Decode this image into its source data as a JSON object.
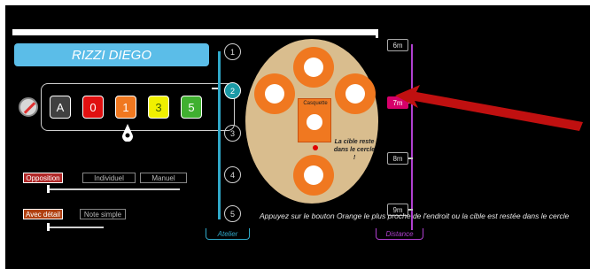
{
  "player": {
    "name": "RIZZI  DIEGO"
  },
  "score_buttons": [
    {
      "label": "A",
      "color": "#404040",
      "border": "#ffffff",
      "text_color": "#ffffff"
    },
    {
      "label": "0",
      "color": "#e01010",
      "border": "#ffffff",
      "text_color": "#ffffff"
    },
    {
      "label": "1",
      "color": "#f07820",
      "border": "#ffffff",
      "text_color": "#ffffff",
      "selected": true
    },
    {
      "label": "3",
      "color": "#f0f000",
      "border": "#ffffff",
      "text_color": "#406000"
    },
    {
      "label": "5",
      "color": "#40b030",
      "border": "#ffffff",
      "text_color": "#ffffff"
    }
  ],
  "mode_options": {
    "opposition": "Opposition",
    "individuel": "Individuel",
    "manuel": "Manuel",
    "selected": "Opposition"
  },
  "detail_options": {
    "avec_detail": "Avec détail",
    "note_simple": "Note simple",
    "selected": "Avec détail"
  },
  "atelier": {
    "steps": [
      "1",
      "2",
      "3",
      "4",
      "5"
    ],
    "active": "2",
    "legend": "Atelier"
  },
  "distance": {
    "options": [
      "6m",
      "7m",
      "8m",
      "9m"
    ],
    "active": "7m",
    "legend": "Distance"
  },
  "target": {
    "center_label": "Casquette",
    "note": "La cible reste dans le cercle !"
  },
  "instruction": "Appuyez sur le bouton Orange le plus proche de l'endroit ou la cible est restée dans le cercle",
  "icons": {
    "compass": "compass-icon",
    "pointer": "drop-pointer-icon",
    "arrow": "red-arrow-icon"
  },
  "colors": {
    "accent": "#30a8c8",
    "distance": "#b040d0",
    "highlight": "#d6006a",
    "target": "#f07820"
  }
}
